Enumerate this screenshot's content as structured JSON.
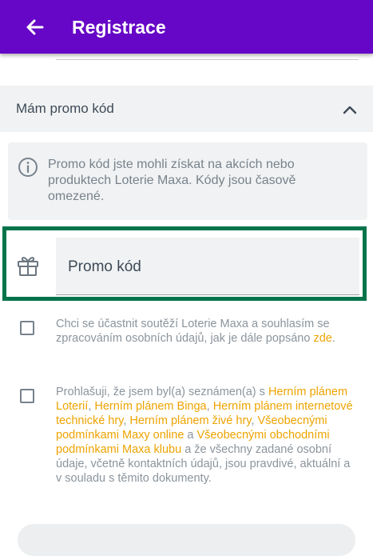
{
  "appbar": {
    "title": "Registrace",
    "back_icon": "arrow-left-icon",
    "color": "#6606c6"
  },
  "promo_section": {
    "header_label": "Mám promo kód",
    "expanded": true,
    "info_text": "Promo kód jste mohli získat na akcích nebo produktech Loterie Maxa. Kódy jsou časově omezené.",
    "input_placeholder": "Promo kód",
    "input_value": "",
    "highlight_color": "#02734b"
  },
  "consent_marketing": {
    "checked": false,
    "text": "Chci se účastnit soutěží Loterie Maxa a souhlasím se zpracováním osobních údajů, jak je dále popsáno ",
    "link": "zde",
    "tail": "."
  },
  "consent_terms": {
    "checked": false,
    "t1": "Prohlašuji, že jsem byl(a) seznámen(a) s ",
    "l1": "Herním plánem Loterií",
    "t2": ", ",
    "l2": "Herním plánem Binga",
    "t3": ", ",
    "l3": "Herním plánem internetové technické hry",
    "t4": ", ",
    "l4": "Herním plánem živé hry",
    "t5": ", ",
    "l5": "Všeobecnými podmínkami Maxy online",
    "t6": " a ",
    "l6": "Všeobecnými obchodními podmínkami Maxa klubu",
    "t7": " a že všechny zadané osobní údaje, včetně kontaktních údajů, jsou pravdivé, aktuální a v souladu s těmito dokumenty."
  },
  "colors": {
    "link": "#eda300",
    "muted_text": "#8b949c",
    "panel": "#f1f2f3"
  }
}
